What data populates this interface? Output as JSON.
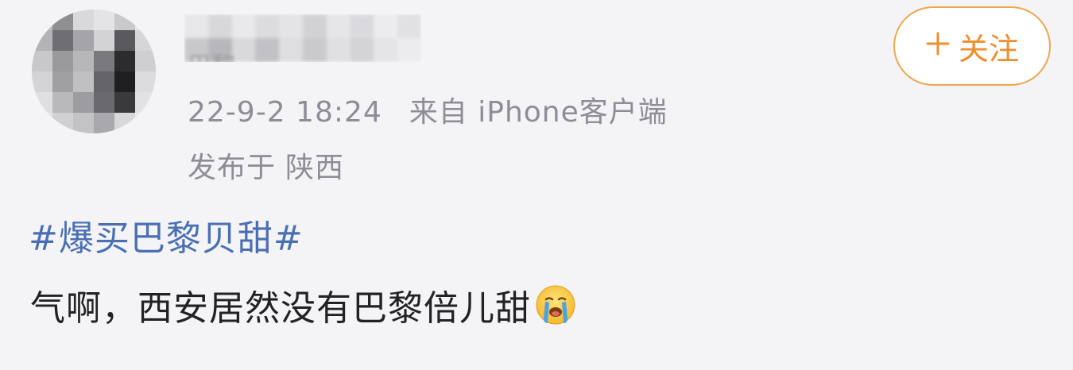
{
  "user": {
    "avatar_icon": "avatar-pixelated",
    "username_hidden": "巴黎"
  },
  "meta": {
    "time": "22-9-2 18:24",
    "source": "来自 iPhone客户端",
    "location_label": "发布于",
    "location": "陕西"
  },
  "follow": {
    "icon": "plus-icon",
    "label": "关注",
    "color": "#ef8e2c"
  },
  "post": {
    "topic": "#爆买巴黎贝甜#",
    "text": "气啊，西安居然没有巴黎倍儿甜",
    "emoji": "crying-face-emoji",
    "topic_color": "#4a6fb3"
  }
}
